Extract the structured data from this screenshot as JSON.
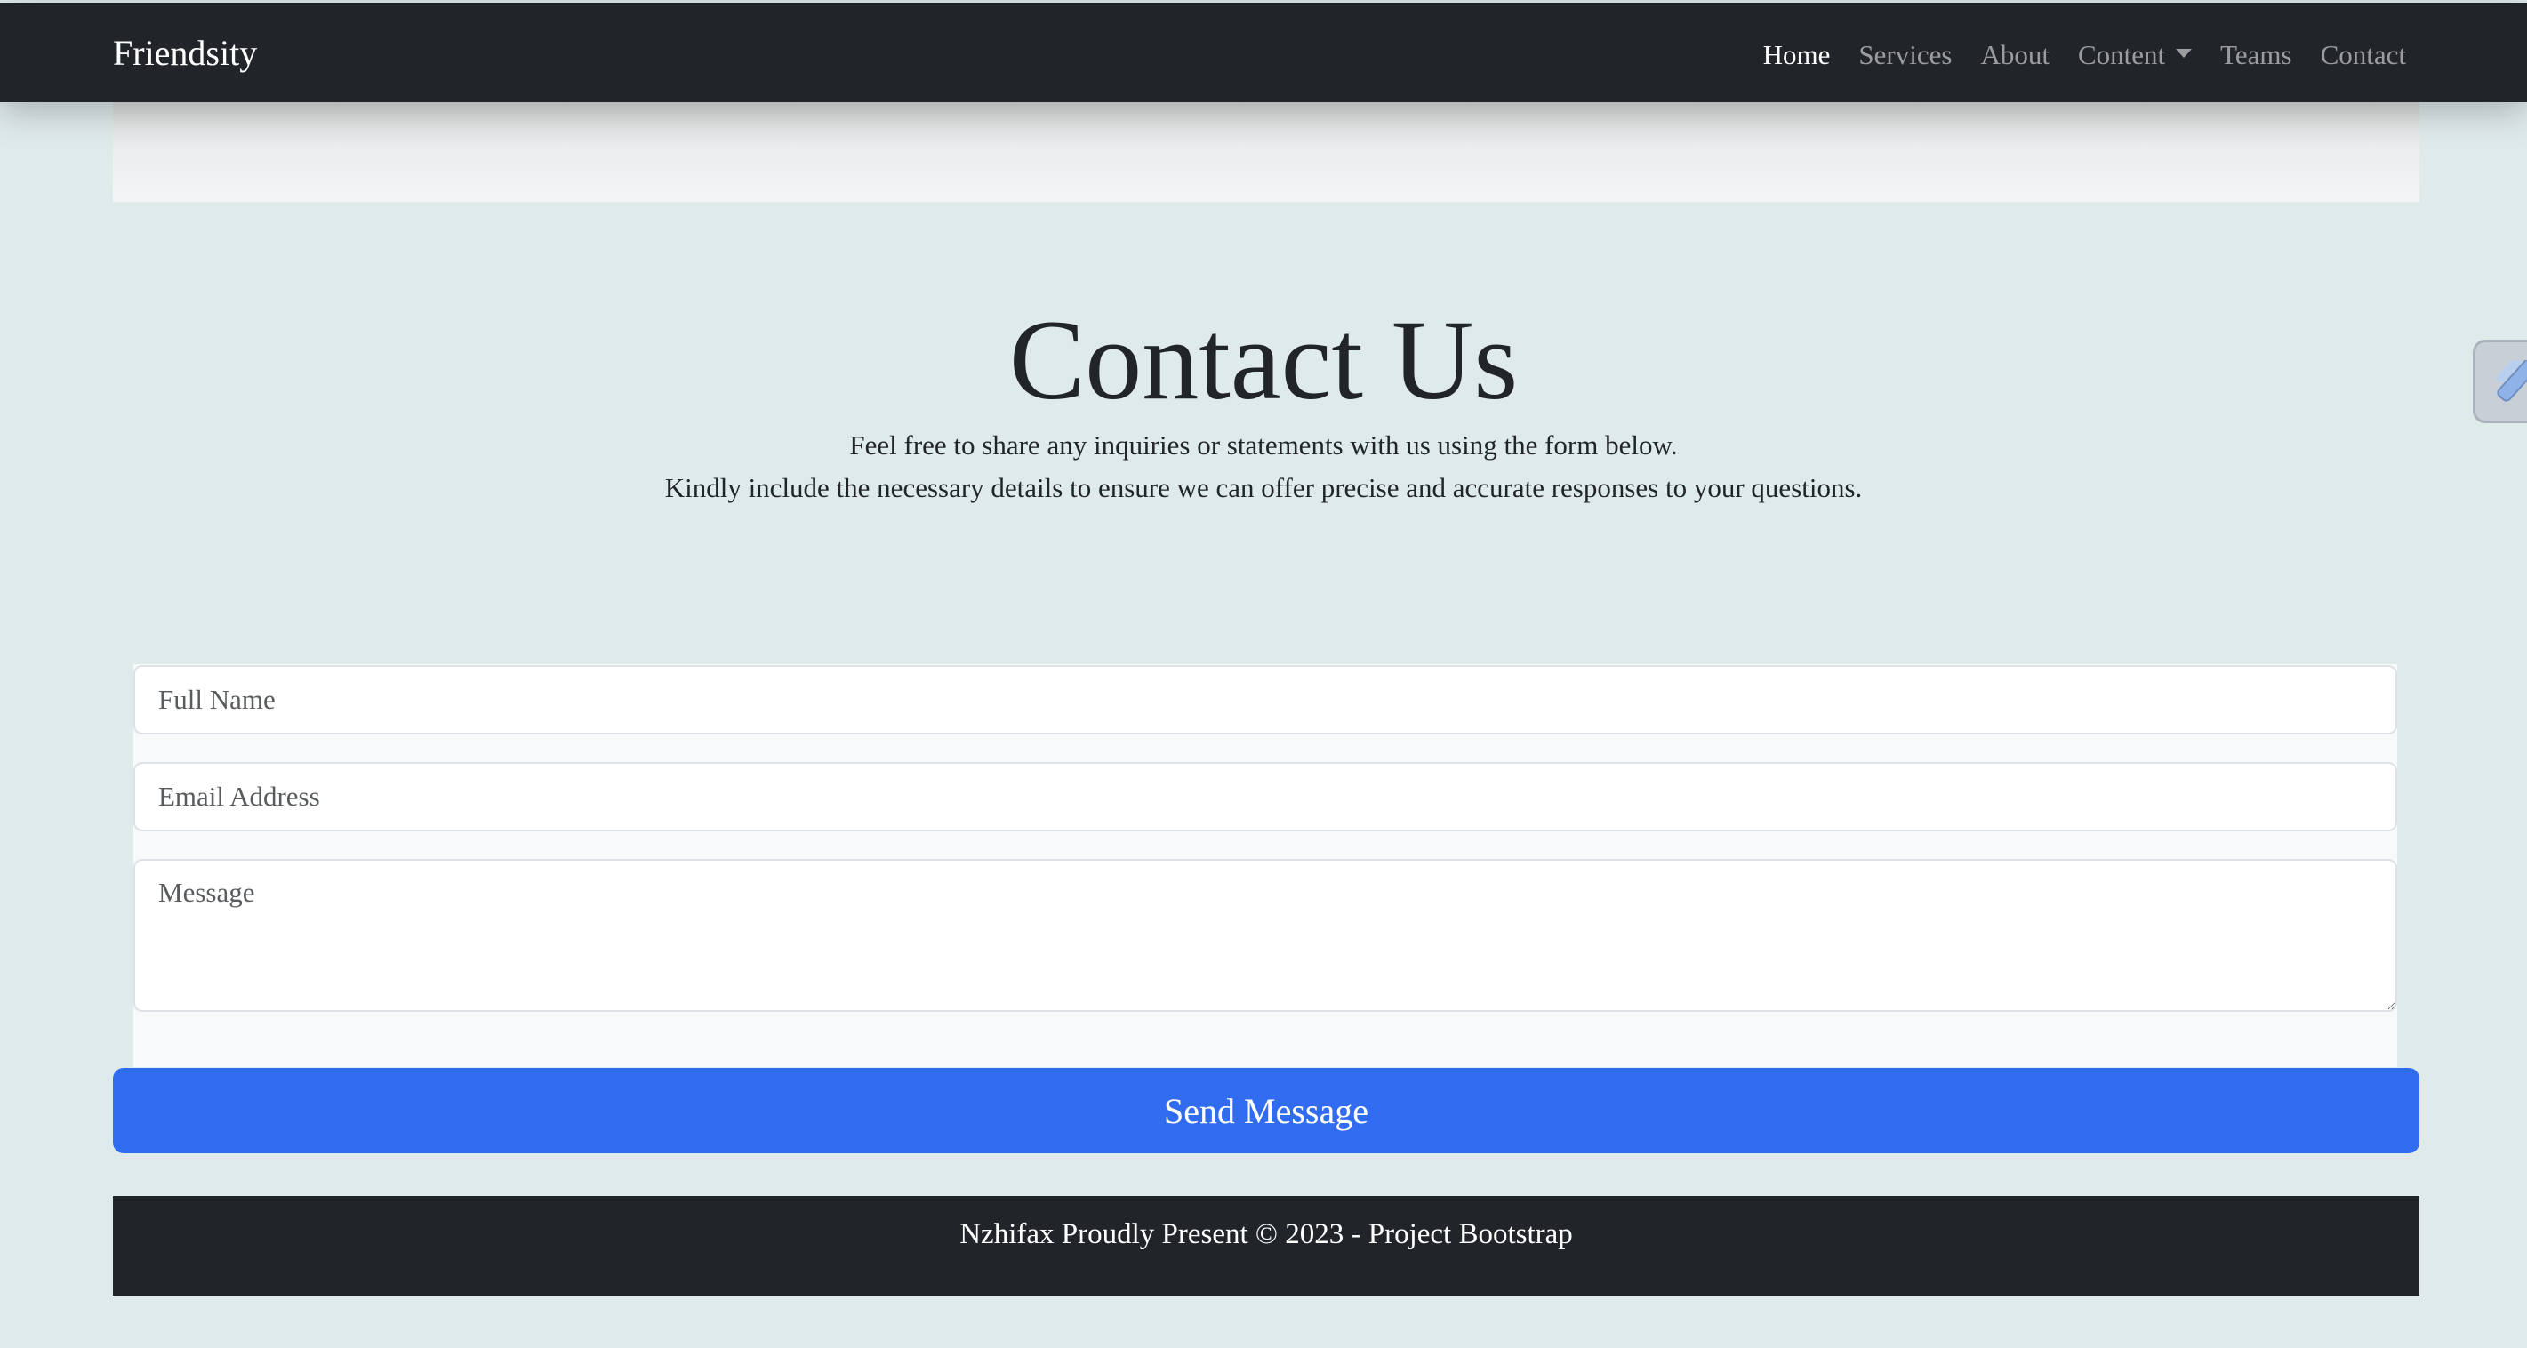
{
  "navbar": {
    "brand": "Friendsity",
    "items": [
      {
        "label": "Home",
        "active": true
      },
      {
        "label": "Services"
      },
      {
        "label": "About"
      },
      {
        "label": "Content",
        "dropdown": true
      },
      {
        "label": "Teams"
      },
      {
        "label": "Contact"
      }
    ]
  },
  "hero": {
    "title": "Contact Us",
    "line1": "Feel free to share any inquiries or statements with us using the form below.",
    "line2": "Kindly include the necessary details to ensure we can offer precise and accurate responses to your questions."
  },
  "form": {
    "name_placeholder": "Full Name",
    "email_placeholder": "Email Address",
    "message_placeholder": "Message",
    "submit_label": "Send Message"
  },
  "footer": {
    "text": "Nzhifax Proudly Present © 2023 - Project Bootstrap"
  },
  "colors": {
    "page_bg": "#dfeaea",
    "navbar_bg": "#212529",
    "button_bg": "#316bef",
    "footer_bg": "#212529"
  },
  "icons": {
    "side_tab": "pen-icon"
  }
}
